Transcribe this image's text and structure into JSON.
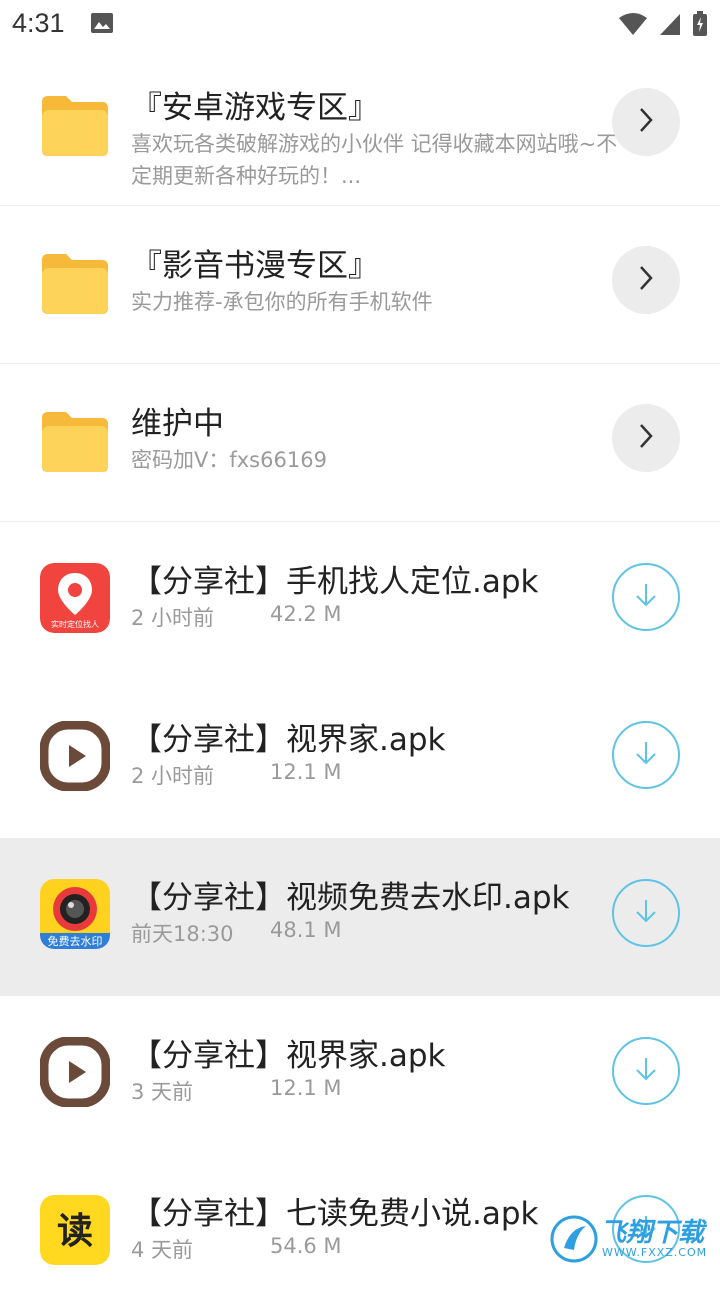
{
  "status_bar": {
    "time": "4:31"
  },
  "folders": [
    {
      "title": "『安卓游戏专区』",
      "subtitle": "喜欢玩各类破解游戏的小伙伴 记得收藏本网站哦~不定期更新各种好玩的！..."
    },
    {
      "title": "『影音书漫专区』",
      "subtitle": "实力推荐-承包你的所有手机软件"
    },
    {
      "title": "维护中",
      "subtitle": "密码加V：fxs66169"
    }
  ],
  "files": [
    {
      "title": "【分享社】手机找人定位.apk",
      "time": "2 小时前",
      "size": "42.2 M",
      "icon": "location-app-icon",
      "icon_label": "实时定位找人"
    },
    {
      "title": "【分享社】视界家.apk",
      "time": "2 小时前",
      "size": "12.1 M",
      "icon": "play-app-icon"
    },
    {
      "title": "【分享社】视频免费去水印.apk",
      "time": "前天18:30",
      "size": "48.1 M",
      "icon": "camera-app-icon",
      "icon_label": "免费去水印",
      "highlighted": true
    },
    {
      "title": "【分享社】视界家.apk",
      "time": "3 天前",
      "size": "12.1 M",
      "icon": "play-app-icon"
    },
    {
      "title": "【分享社】七读免费小说.apk",
      "time": "4 天前",
      "size": "54.6 M",
      "icon": "read-app-icon",
      "icon_label": "读"
    }
  ],
  "watermark": {
    "text": "飞翔下载",
    "sub": "WWW.FXXZ.COM"
  },
  "colors": {
    "folder": "#fdd35a",
    "download": "#5ec3e6",
    "highlight": "#ececec"
  }
}
